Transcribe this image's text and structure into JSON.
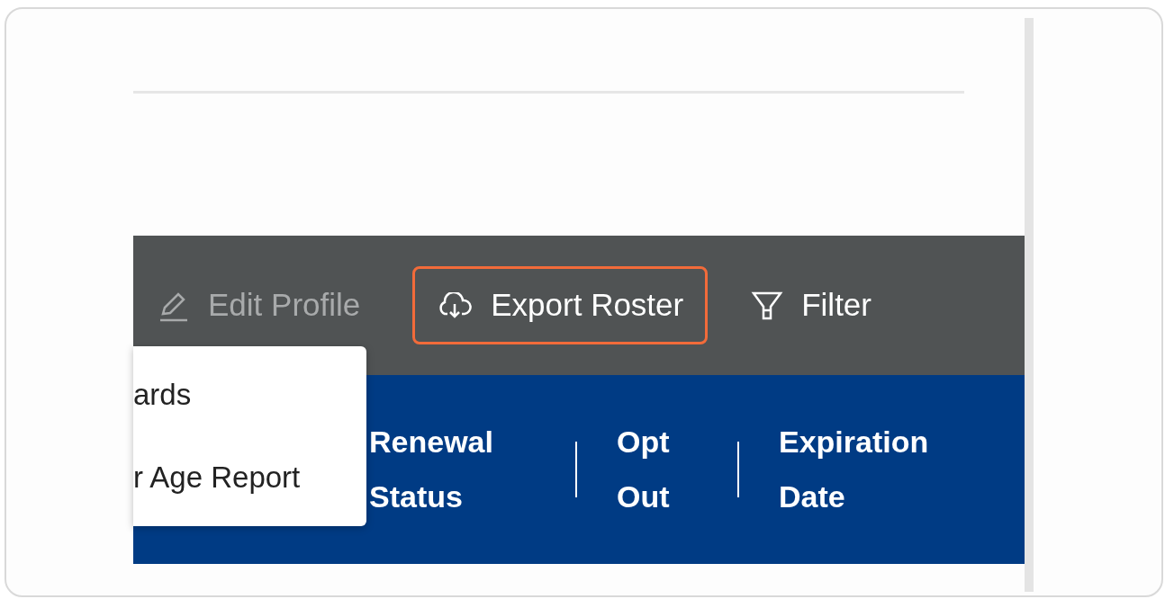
{
  "toolbar": {
    "actions": [
      {
        "kind": "edit",
        "label": "Edit Profile",
        "disabled": true,
        "highlighted": false
      },
      {
        "kind": "export",
        "label": "Export Roster",
        "disabled": false,
        "highlighted": true
      },
      {
        "kind": "filter",
        "label": "Filter",
        "disabled": false,
        "highlighted": false
      }
    ]
  },
  "menu": {
    "items": [
      {
        "label": "ards"
      },
      {
        "label": "r Age Report"
      }
    ]
  },
  "table": {
    "columns": [
      {
        "label": "Renewal Status"
      },
      {
        "label": "Opt Out"
      },
      {
        "label": "Expiration Date"
      }
    ]
  }
}
